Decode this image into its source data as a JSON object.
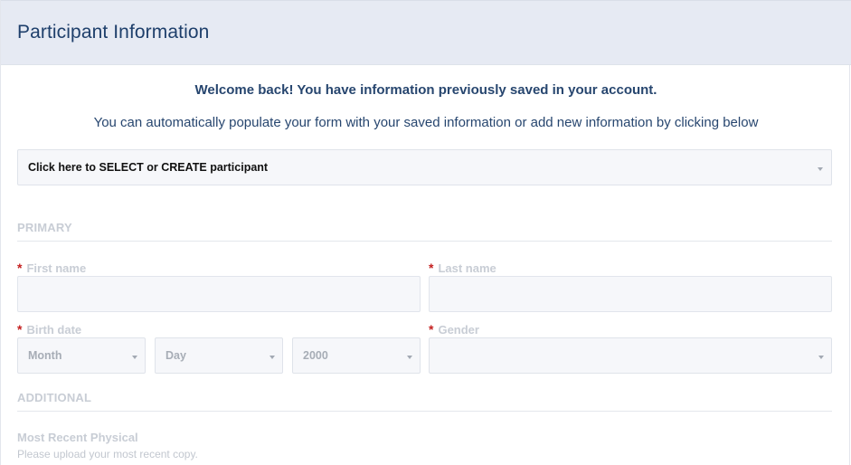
{
  "header": {
    "title": "Participant Information"
  },
  "intro": {
    "welcome": "Welcome back! You have information previously saved in your account.",
    "subtext": "You can automatically populate your form with your saved information or add new information by clicking below"
  },
  "participant_select": {
    "value": "Click here to SELECT or CREATE participant"
  },
  "sections": {
    "primary": "PRIMARY",
    "additional": "ADDITIONAL"
  },
  "required_marker": "*",
  "fields": {
    "first_name": {
      "label": "First name",
      "value": ""
    },
    "last_name": {
      "label": "Last name",
      "value": ""
    },
    "birth_date": {
      "label": "Birth date",
      "month": "Month",
      "day": "Day",
      "year": "2000"
    },
    "gender": {
      "label": "Gender",
      "value": ""
    },
    "physical": {
      "label": "Most Recent Physical",
      "hint": "Please upload your most recent copy."
    }
  },
  "colors": {
    "header_bg": "#e6eaf3",
    "title_text": "#1e3f6b",
    "required": "#c41f1f",
    "muted_label": "#c8cdd5"
  }
}
